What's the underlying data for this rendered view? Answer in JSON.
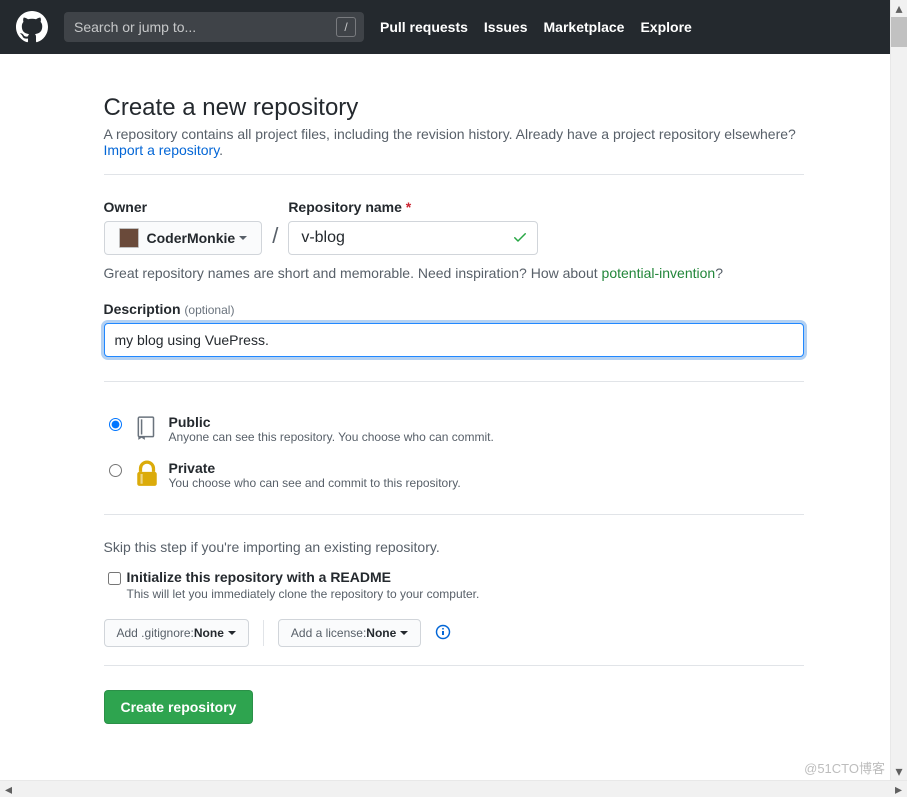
{
  "header": {
    "search_placeholder": "Search or jump to...",
    "slash_key": "/",
    "nav": {
      "pulls": "Pull requests",
      "issues": "Issues",
      "marketplace": "Marketplace",
      "explore": "Explore"
    }
  },
  "page": {
    "title": "Create a new repository",
    "lead_text": "A repository contains all project files, including the revision history. Already have a project repository elsewhere?",
    "import_link": "Import a repository",
    "period": "."
  },
  "owner": {
    "label": "Owner",
    "name": "CoderMonkie"
  },
  "repo": {
    "label": "Repository name",
    "value": "v-blog"
  },
  "hint": {
    "pre": "Great repository names are short and memorable. Need inspiration? How about ",
    "suggestion": "potential-invention",
    "post": "?"
  },
  "description": {
    "label": "Description",
    "optional": "(optional)",
    "value": "my blog using VuePress."
  },
  "visibility": {
    "public": {
      "title": "Public",
      "desc": "Anyone can see this repository. You choose who can commit."
    },
    "private": {
      "title": "Private",
      "desc": "You choose who can see and commit to this repository."
    }
  },
  "skip_text": "Skip this step if you're importing an existing repository.",
  "readme": {
    "title": "Initialize this repository with a README",
    "desc": "This will let you immediately clone the repository to your computer."
  },
  "selects": {
    "gitignore_pre": "Add .gitignore: ",
    "gitignore_val": "None",
    "license_pre": "Add a license: ",
    "license_val": "None"
  },
  "submit": "Create repository",
  "watermark": "@51CTO博客"
}
